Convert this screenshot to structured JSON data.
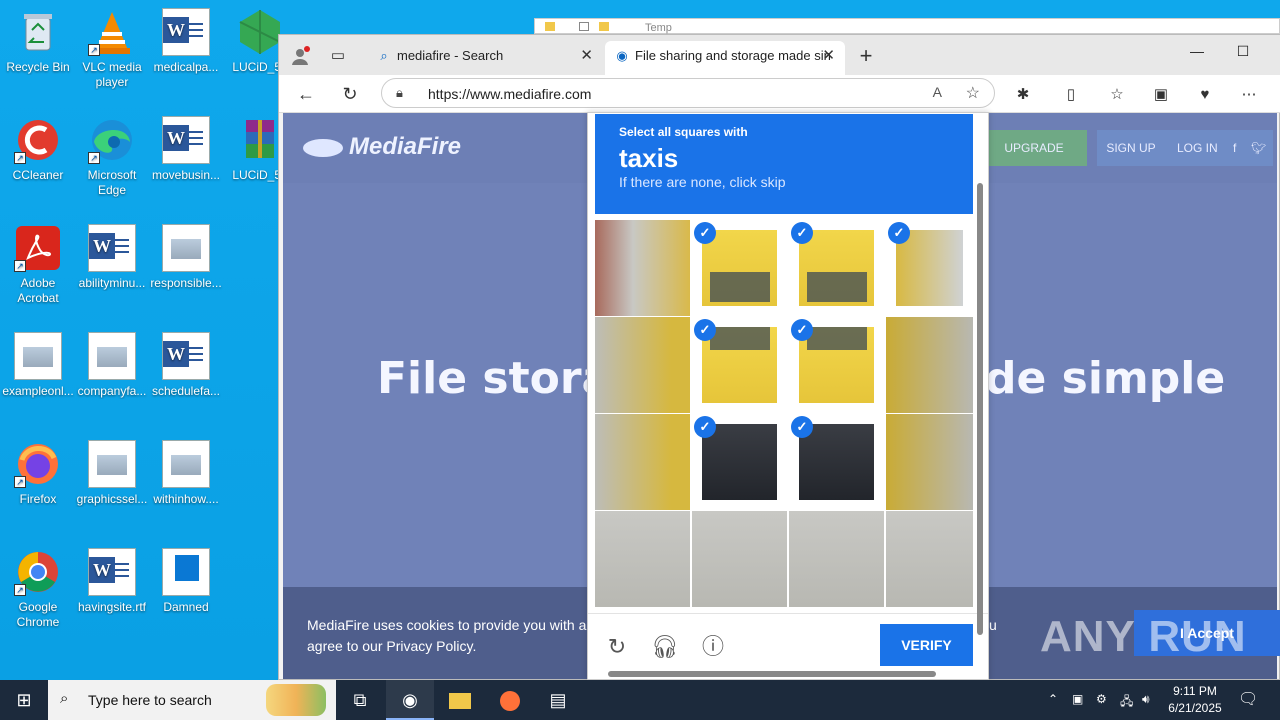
{
  "desktop": {
    "icons": [
      {
        "label": "Recycle Bin"
      },
      {
        "label": "VLC media player"
      },
      {
        "label": "medicalpa..."
      },
      {
        "label": "LUCiD_5e"
      },
      {
        "label": "CCleaner"
      },
      {
        "label": "Microsoft Edge"
      },
      {
        "label": "movebusin..."
      },
      {
        "label": "LUCiD_5e"
      },
      {
        "label": "Adobe Acrobat"
      },
      {
        "label": "abilityminu..."
      },
      {
        "label": "responsible..."
      },
      {
        "label": "exampleonl..."
      },
      {
        "label": "companyfa..."
      },
      {
        "label": "schedulefa..."
      },
      {
        "label": "Firefox"
      },
      {
        "label": "graphicssel..."
      },
      {
        "label": "withinhow...."
      },
      {
        "label": "Google Chrome"
      },
      {
        "label": "havingsite.rtf"
      },
      {
        "label": "Damned"
      }
    ]
  },
  "bg_window": {
    "title": "Temp"
  },
  "browser": {
    "tabs": [
      {
        "label": "mediafire - Search",
        "favicon": "search-icon"
      },
      {
        "label": "File sharing and storage made sin",
        "favicon": "edge-icon"
      }
    ],
    "url": "https://www.mediafire.com"
  },
  "page": {
    "logo": "MediaFire",
    "upgrade": "UPGRADE",
    "signup": "SIGN UP",
    "login": "LOG IN",
    "hero_left": "File storag",
    "hero_right": "de simple",
    "cookie_text": "MediaFire uses cookies to provide you with a p agree to our Privacy Policy.",
    "cookie_end": "u",
    "accept": "I Accept"
  },
  "captcha": {
    "line1": "Select all squares with",
    "keyword": "taxis",
    "line3": "If there are none, click skip",
    "verify": "VERIFY",
    "tiles_selected": [
      1,
      2,
      3,
      5,
      6,
      9,
      10
    ]
  },
  "watermark": "ANY RUN",
  "taskbar": {
    "search_placeholder": "Type here to search",
    "time": "9:11 PM",
    "date": "6/21/2025"
  },
  "colors": {
    "accent": "#1a73e8",
    "taskbar": "#1c2a3c",
    "desktop": "#0da2e8"
  }
}
